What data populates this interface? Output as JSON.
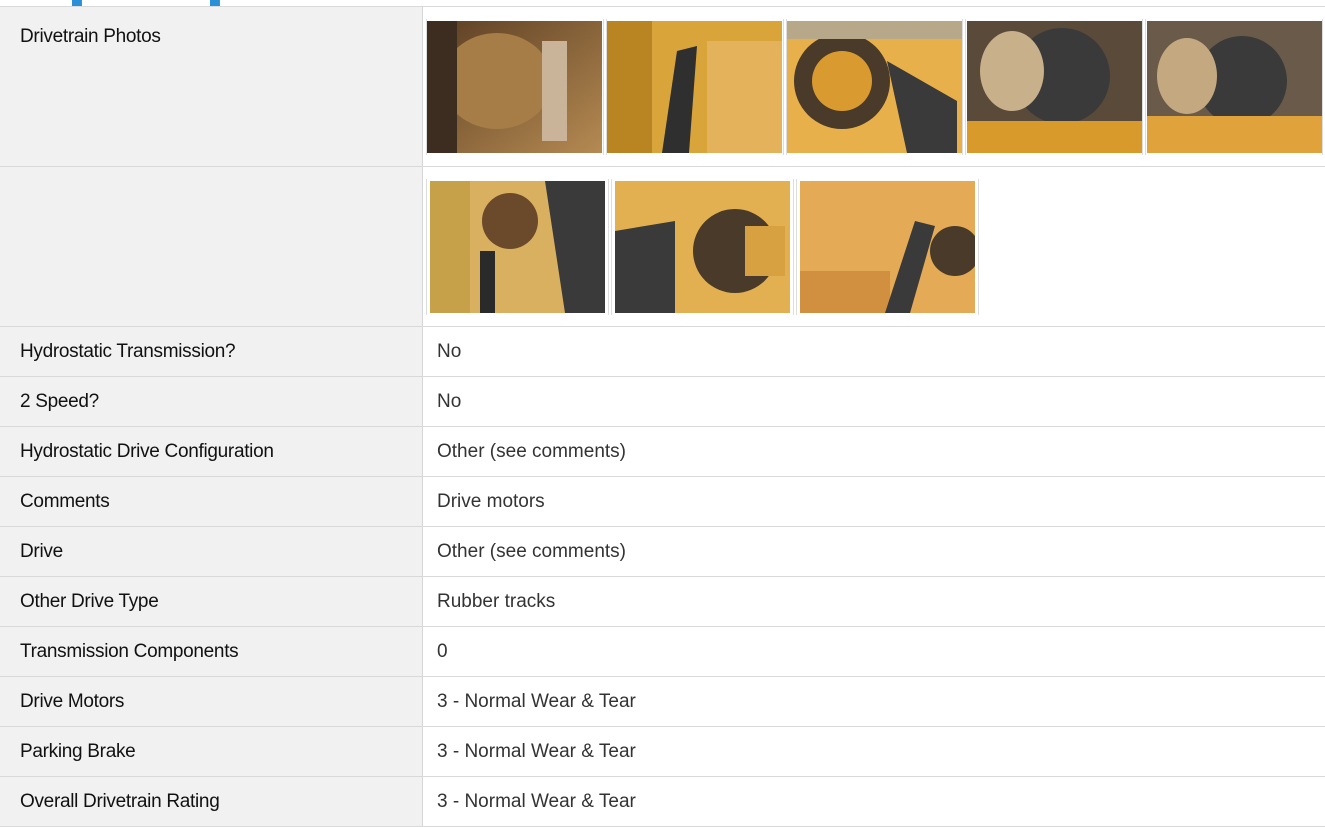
{
  "colors": {
    "accent": "#2a8fd6",
    "label_bg": "#f1f1f1",
    "border": "#d9d9d9"
  },
  "photos": {
    "label": "Drivetrain Photos",
    "row1": [
      {
        "icon": "track-hub-photo-1",
        "tone": "#8a6a3c"
      },
      {
        "icon": "hydraulic-hose-photo-2",
        "tone": "#d7a53a"
      },
      {
        "icon": "sprocket-photo-3",
        "tone": "#e3a53a"
      },
      {
        "icon": "sprocket-motor-photo-4",
        "tone": "#6b5a40"
      },
      {
        "icon": "sprocket-motor-photo-5",
        "tone": "#7a6a50"
      }
    ],
    "row2": [
      {
        "icon": "drive-motor-photo-6",
        "tone": "#caa04a"
      },
      {
        "icon": "sprocket-photo-7",
        "tone": "#d9a84a"
      },
      {
        "icon": "frame-photo-8",
        "tone": "#e0a856"
      }
    ]
  },
  "rows": [
    {
      "label": "Hydrostatic Transmission?",
      "value": "No"
    },
    {
      "label": "2 Speed?",
      "value": "No"
    },
    {
      "label": "Hydrostatic Drive Configuration",
      "value": "Other (see comments)"
    },
    {
      "label": "Comments",
      "value": "Drive motors"
    },
    {
      "label": "Drive",
      "value": "Other (see comments)"
    },
    {
      "label": "Other Drive Type",
      "value": "Rubber tracks"
    },
    {
      "label": "Transmission Components",
      "value": "0"
    },
    {
      "label": "Drive Motors",
      "value": "3 - Normal Wear & Tear"
    },
    {
      "label": "Parking Brake",
      "value": "3 - Normal Wear & Tear"
    },
    {
      "label": "Overall Drivetrain Rating",
      "value": "3 - Normal Wear & Tear"
    }
  ]
}
